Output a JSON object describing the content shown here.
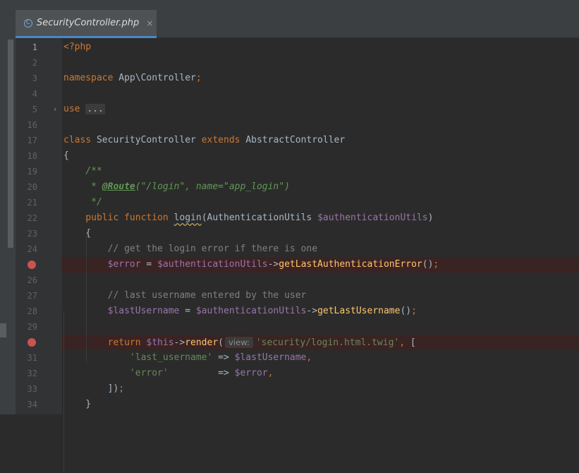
{
  "tabs": [
    {
      "label": "SecurityController.php",
      "icon": "class-icon",
      "icon_glyph": "C",
      "active": true
    }
  ],
  "code_lines": [
    {
      "num": "1",
      "current": true,
      "tokens": [
        {
          "t": "<?php",
          "c": "phptag"
        }
      ]
    },
    {
      "num": "2",
      "tokens": []
    },
    {
      "num": "3",
      "tokens": [
        {
          "t": "namespace ",
          "c": "kw"
        },
        {
          "t": "App\\Controller",
          "c": ""
        },
        {
          "t": ";",
          "c": "kw"
        }
      ]
    },
    {
      "num": "4",
      "tokens": []
    },
    {
      "num": "5",
      "fold": true,
      "tokens": [
        {
          "t": "use ",
          "c": "kw"
        },
        {
          "t": "...",
          "c": "folded"
        }
      ]
    },
    {
      "num": "16",
      "tokens": []
    },
    {
      "num": "17",
      "tokens": [
        {
          "t": "class ",
          "c": "kw"
        },
        {
          "t": "SecurityController ",
          "c": ""
        },
        {
          "t": "extends ",
          "c": "kw"
        },
        {
          "t": "AbstractController",
          "c": ""
        }
      ]
    },
    {
      "num": "18",
      "tokens": [
        {
          "t": "{",
          "c": ""
        }
      ]
    },
    {
      "num": "19",
      "tokens": [
        {
          "t": "    /**",
          "c": "doc"
        }
      ]
    },
    {
      "num": "20",
      "tokens": [
        {
          "t": "     * ",
          "c": "doc"
        },
        {
          "t": "@Route",
          "c": "annot"
        },
        {
          "t": "(\"/login\", name=\"app_login\")",
          "c": "doc"
        }
      ]
    },
    {
      "num": "21",
      "tokens": [
        {
          "t": "     */",
          "c": "doc"
        }
      ]
    },
    {
      "num": "22",
      "tokens": [
        {
          "t": "    public function ",
          "c": "kw"
        },
        {
          "t": "login",
          "c": "fnplain"
        },
        {
          "t": "(AuthenticationUtils ",
          "c": ""
        },
        {
          "t": "$authenticationUtils",
          "c": "var"
        },
        {
          "t": ")",
          "c": ""
        }
      ]
    },
    {
      "num": "23",
      "tokens": [
        {
          "t": "    {",
          "c": ""
        }
      ]
    },
    {
      "num": "24",
      "tokens": [
        {
          "t": "        // get the login error if there is one",
          "c": "cmt"
        }
      ]
    },
    {
      "num": "25",
      "breakpoint": true,
      "tokens": [
        {
          "t": "        $error",
          "c": "var"
        },
        {
          "t": " = ",
          "c": ""
        },
        {
          "t": "$authenticationUtils",
          "c": "var"
        },
        {
          "t": "->",
          "c": ""
        },
        {
          "t": "getLastAuthenticationError",
          "c": "fn"
        },
        {
          "t": "()",
          "c": ""
        },
        {
          "t": ";",
          "c": "kw"
        }
      ]
    },
    {
      "num": "26",
      "tokens": []
    },
    {
      "num": "27",
      "tokens": [
        {
          "t": "        // last username entered by the user",
          "c": "cmt"
        }
      ]
    },
    {
      "num": "28",
      "tokens": [
        {
          "t": "        $lastUsername",
          "c": "var"
        },
        {
          "t": " = ",
          "c": ""
        },
        {
          "t": "$authenticationUtils",
          "c": "var"
        },
        {
          "t": "->",
          "c": ""
        },
        {
          "t": "getLastUsername",
          "c": "fn"
        },
        {
          "t": "()",
          "c": ""
        },
        {
          "t": ";",
          "c": "kw"
        }
      ]
    },
    {
      "num": "29",
      "tokens": []
    },
    {
      "num": "30",
      "breakpoint": true,
      "tokens": [
        {
          "t": "        return ",
          "c": "kw"
        },
        {
          "t": "$this",
          "c": "var"
        },
        {
          "t": "->",
          "c": ""
        },
        {
          "t": "render",
          "c": "fn"
        },
        {
          "t": "(",
          "c": ""
        },
        {
          "t": "view:",
          "c": "hint"
        },
        {
          "t": "'security/login.html.twig'",
          "c": "str"
        },
        {
          "t": ", ",
          "c": "kw"
        },
        {
          "t": "[",
          "c": ""
        }
      ]
    },
    {
      "num": "31",
      "tokens": [
        {
          "t": "            'last_username'",
          "c": "str"
        },
        {
          "t": " => ",
          "c": ""
        },
        {
          "t": "$lastUsername",
          "c": "var"
        },
        {
          "t": ",",
          "c": "kw"
        }
      ]
    },
    {
      "num": "32",
      "tokens": [
        {
          "t": "            'error'",
          "c": "str"
        },
        {
          "t": "         => ",
          "c": ""
        },
        {
          "t": "$error",
          "c": "var"
        },
        {
          "t": ",",
          "c": "kw"
        }
      ]
    },
    {
      "num": "33",
      "tokens": [
        {
          "t": "        ])",
          "c": ""
        },
        {
          "t": ";",
          "c": "kw"
        }
      ]
    },
    {
      "num": "34",
      "tokens": [
        {
          "t": "    }",
          "c": ""
        }
      ]
    }
  ]
}
